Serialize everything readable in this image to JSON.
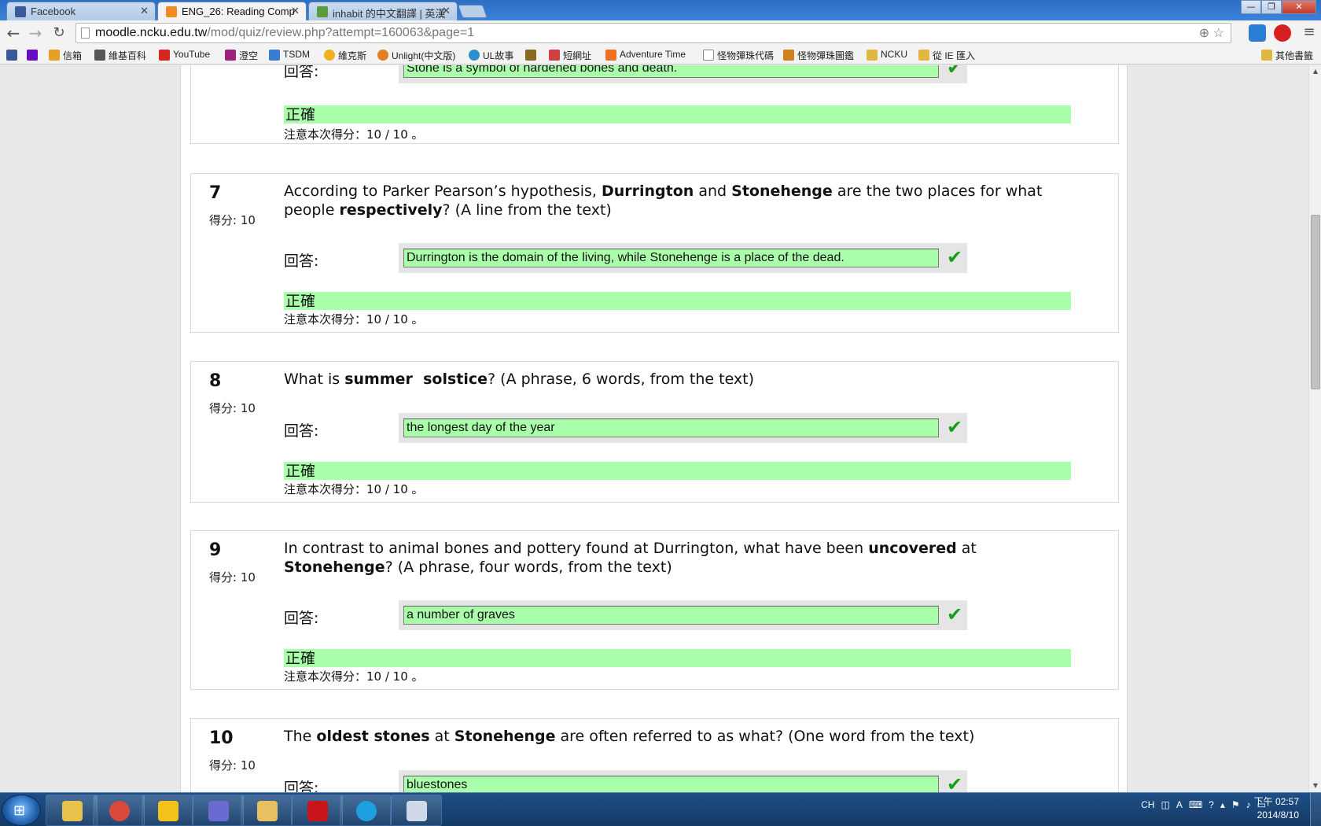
{
  "browser": {
    "tabs": [
      {
        "title": "Facebook",
        "color": "#3b5998"
      },
      {
        "title": "ENG_26: Reading Comp",
        "color": "#f08a24"
      },
      {
        "title": "inhabit 的中文翻譯 | 英漢",
        "color": "#5a9b3c"
      }
    ],
    "url_host": "moodle.ncku.edu.tw",
    "url_path": "/mod/quiz/review.php?attempt=160063&page=1",
    "bookmarks": [
      {
        "label": "",
        "color": "#3b5998"
      },
      {
        "label": "",
        "color": "#6b0ac4"
      },
      {
        "label": "信箱",
        "color": "#e8a020"
      },
      {
        "label": "維基百科",
        "color": "#555555"
      },
      {
        "label": "YouTube",
        "color": "#d8261f"
      },
      {
        "label": "澄空",
        "color": "#a02080"
      },
      {
        "label": "TSDM",
        "color": "#3a7dd0"
      },
      {
        "label": "維克斯",
        "color": "#f0b020"
      },
      {
        "label": "Unlight(中文版)",
        "color": "#e08020"
      },
      {
        "label": "UL故事",
        "color": "#2c8fd0"
      },
      {
        "label": "",
        "color": "#8a6a20"
      },
      {
        "label": "短網址",
        "color": "#d04040"
      },
      {
        "label": "Adventure Time",
        "color": "#f07020"
      },
      {
        "label": "怪物彈珠代碼",
        "color": "#888888"
      },
      {
        "label": "怪物彈珠圖鑑",
        "color": "#d08020"
      },
      {
        "label": "NCKU",
        "color": "#e0b840"
      },
      {
        "label": "從 IE 匯入",
        "color": "#e0b840"
      }
    ],
    "other_bookmarks": "其他書籤"
  },
  "quiz": {
    "grade_label": "得分: 10",
    "answer_label": "回答:",
    "correct_label": "正確",
    "score_note": "注意本次得分：10 / 10 。",
    "check_mark": "✔",
    "top_partial": {
      "answer": "Stone is a symbol of hardened bones and death."
    },
    "q7": {
      "number": "7",
      "t1": "According to Parker Pearson’s hypothesis, ",
      "b1": "Durrington",
      "t2": " and ",
      "b2": "Stonehenge",
      "t3": " are the two places for what people ",
      "b3": "respectively",
      "t4": "? (A line from the text)",
      "answer": "Durrington is the domain of the living, while Stonehenge is a place of the dead."
    },
    "q8": {
      "number": "8",
      "t1": "What is ",
      "b1": "summer  solstice",
      "t2": "? (A phrase, 6 words, from the text)",
      "answer": "the longest day of the year"
    },
    "q9": {
      "number": "9",
      "t1": "In contrast to animal bones and pottery found at Durrington, what have been ",
      "b1": "uncovered",
      "t2": " at ",
      "b2": "Stonehenge",
      "t3": "? (A phrase, four words, from the text)",
      "answer": "a number of graves"
    },
    "q10": {
      "number": "10",
      "t1": "The ",
      "b1": "oldest stones",
      "t2": " at ",
      "b2": "Stonehenge",
      "t3": " are often referred to as what? (One word from the text)",
      "answer": "bluestones"
    }
  },
  "taskbar": {
    "apps": [
      {
        "name": "ie",
        "color": "#e8c24a"
      },
      {
        "name": "chrome",
        "color": "#d94a3a"
      },
      {
        "name": "pin",
        "color": "#f2c21a"
      },
      {
        "name": "media",
        "color": "#6a6ad0"
      },
      {
        "name": "explorer",
        "color": "#e8c060"
      },
      {
        "name": "acrobat",
        "color": "#c8141a"
      },
      {
        "name": "skype",
        "color": "#1ea0e0"
      },
      {
        "name": "paint",
        "color": "#cfd9e8"
      }
    ],
    "lang": "CH",
    "time": "下午 02:57",
    "date": "2014/8/10"
  }
}
